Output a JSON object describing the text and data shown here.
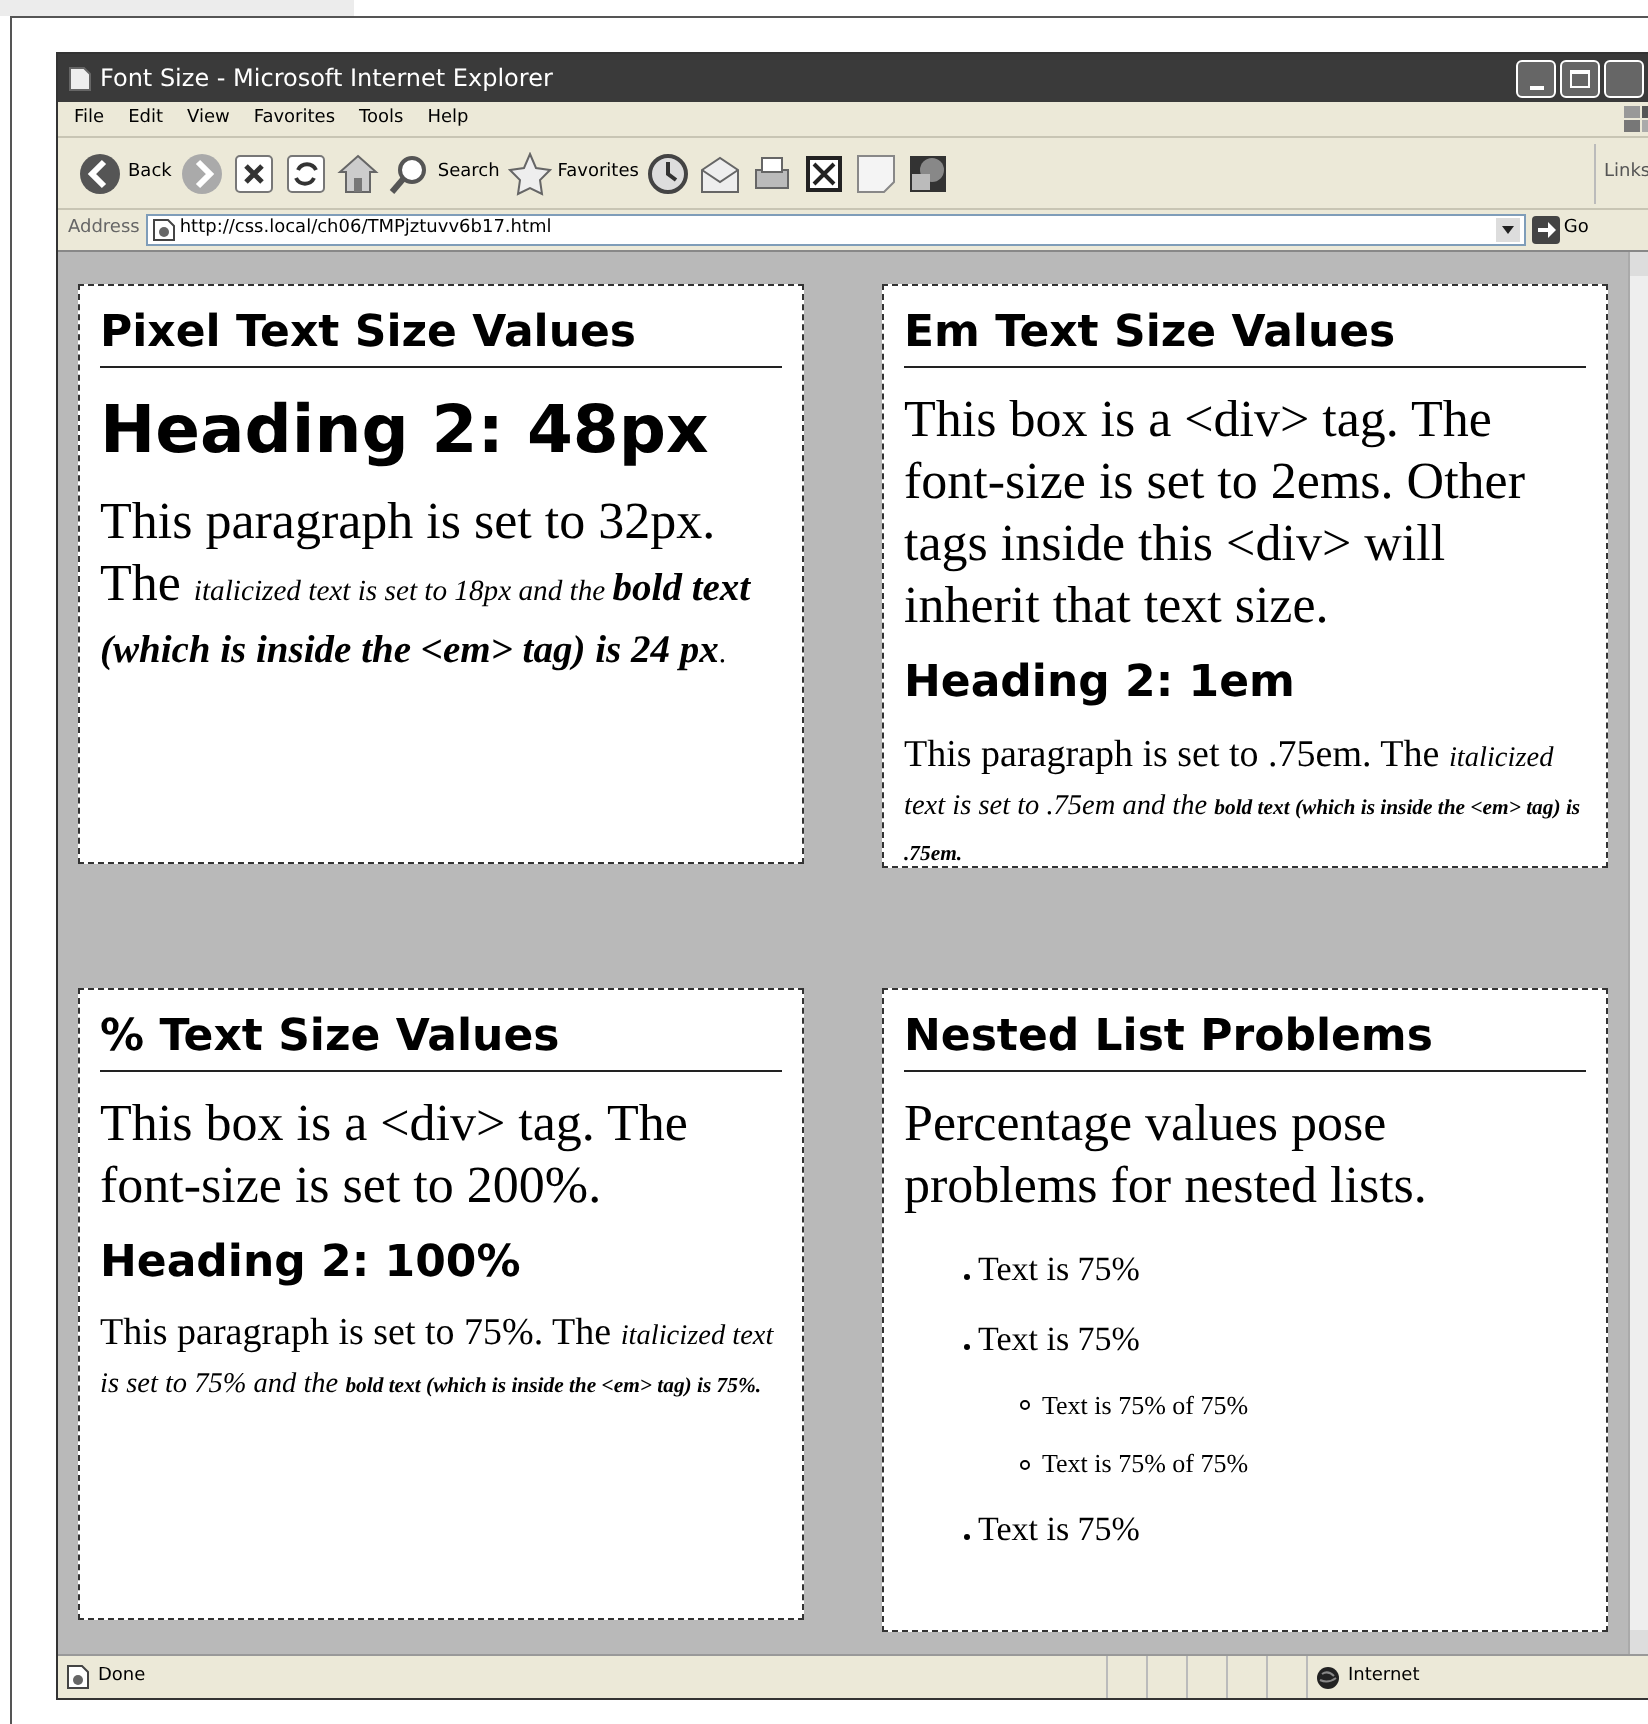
{
  "window": {
    "title": "Font Size - Microsoft Internet Explorer"
  },
  "menu": [
    "File",
    "Edit",
    "View",
    "Favorites",
    "Tools",
    "Help"
  ],
  "toolbar": [
    {
      "kind": "back",
      "label": "Back"
    },
    {
      "kind": "forward"
    },
    {
      "kind": "stop"
    },
    {
      "kind": "refresh"
    },
    {
      "kind": "home"
    },
    {
      "kind": "search",
      "label": "Search"
    },
    {
      "kind": "favorites",
      "label": "Favorites"
    },
    {
      "kind": "history"
    },
    {
      "kind": "mail"
    },
    {
      "kind": "print"
    },
    {
      "kind": "edit"
    },
    {
      "kind": "note"
    },
    {
      "kind": "messenger"
    }
  ],
  "links": "Links",
  "address": {
    "label": "Address",
    "value": "http://css.local/ch06/TMPjztuvv6b17.html",
    "go": "Go"
  },
  "boxes": [
    {
      "title": "Pixel Text Size Values",
      "blocks": [
        {
          "kind": "heading_large",
          "text": "Heading 2: 48px"
        },
        {
          "kind": "paragraph_large",
          "segments": [
            {
              "kind": "plain",
              "text": "This paragraph is set to 32px. The "
            },
            {
              "kind": "italic_small",
              "text": "italicized text is set to 18px and the "
            },
            {
              "kind": "bold_italic_mid",
              "text": "bold text (which is inside the <em> tag) is 24 px"
            },
            {
              "kind": "plain_small",
              "text": "."
            }
          ]
        }
      ]
    },
    {
      "title": "Em Text Size Values",
      "blocks": [
        {
          "kind": "paragraph_large",
          "segments": [
            {
              "kind": "plain",
              "text": "This box is a <div> tag. The font-size is set to 2ems. Other tags inside this <div> will inherit that text size."
            }
          ]
        },
        {
          "kind": "heading",
          "text": "Heading 2: 1em"
        },
        {
          "kind": "paragraph",
          "segments": [
            {
              "kind": "plain",
              "text": "This paragraph is set to .75em. The "
            },
            {
              "kind": "italic_mid",
              "text": "italicized text is set to .75em and the "
            },
            {
              "kind": "bold_italic_small",
              "text": "bold text (which is inside the <em> tag) is .75em."
            }
          ]
        }
      ]
    },
    {
      "title": "% Text Size Values",
      "blocks": [
        {
          "kind": "paragraph_large",
          "segments": [
            {
              "kind": "plain",
              "text": "This box is a <div> tag. The font-size is set to 200%."
            }
          ]
        },
        {
          "kind": "heading",
          "text": "Heading 2: 100%"
        },
        {
          "kind": "paragraph",
          "segments": [
            {
              "kind": "plain",
              "text": "This paragraph is set to 75%. The "
            },
            {
              "kind": "italic_mid",
              "text": "italicized text is set to 75% and the "
            },
            {
              "kind": "bold_italic_small",
              "text": "bold text (which is inside the <em> tag) is 75%."
            }
          ]
        }
      ]
    },
    {
      "title": "Nested List Problems",
      "blocks": [
        {
          "kind": "paragraph_large",
          "segments": [
            {
              "kind": "plain",
              "text": "Percentage values pose problems for nested lists."
            }
          ]
        },
        {
          "kind": "list",
          "items": [
            {
              "text": "Text is 75%"
            },
            {
              "text": "Text is 75%",
              "children": [
                {
                  "text": "Text is 75% of 75%"
                },
                {
                  "text": "Text is 75% of 75%"
                }
              ]
            },
            {
              "text": "Text is 75%"
            }
          ]
        }
      ]
    }
  ],
  "status_bar": {
    "text": "Done",
    "zone": "Internet"
  }
}
